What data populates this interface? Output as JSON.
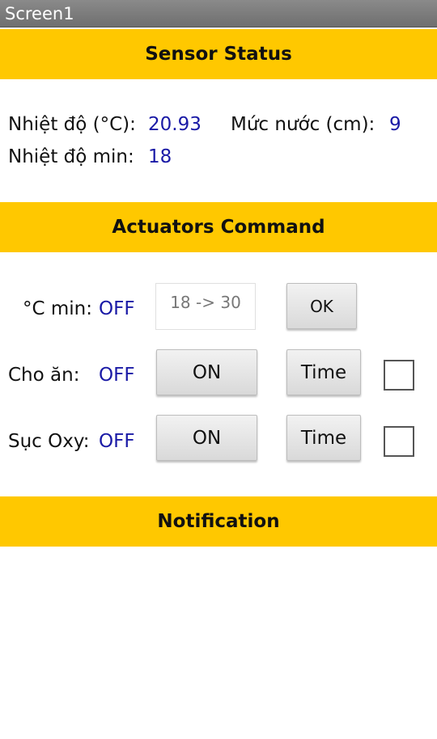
{
  "window": {
    "title": "Screen1"
  },
  "sensor_status": {
    "header": "Sensor Status",
    "temperature_label": "Nhiệt độ (°C):",
    "temperature_value": "20.93",
    "water_level_label": "Mức nước (cm):",
    "water_level_value": "9",
    "temp_min_label": "Nhiệt độ min:",
    "temp_min_value": "18"
  },
  "actuators": {
    "header": "Actuators Command",
    "temp_min": {
      "label": "°C min:",
      "status": "OFF",
      "input_placeholder": "18 -> 30",
      "ok_label": "OK"
    },
    "feeding": {
      "label": "Cho ăn:",
      "status": "OFF",
      "on_label": "ON",
      "time_label": "Time",
      "checked": false
    },
    "oxygen": {
      "label": "Sục Oxy:",
      "status": "OFF",
      "on_label": "ON",
      "time_label": "Time",
      "checked": false
    }
  },
  "notification": {
    "header": "Notification"
  },
  "colors": {
    "header_bg": "#ffc800",
    "value_text": "#1a1aa6",
    "titlebar_bg": "#7a7a7a"
  }
}
